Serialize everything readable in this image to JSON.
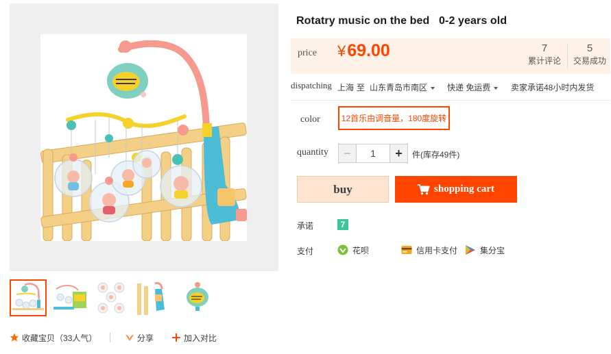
{
  "gallery": {
    "main_image_alt": "",
    "thumbnails": [
      "thumb-crib-mobile",
      "thumb-box",
      "thumb-figures",
      "thumb-arm",
      "thumb-speaker"
    ]
  },
  "actions": {
    "favorite_label": "收藏宝贝",
    "favorite_count": "（33人气）",
    "share_label": "分享",
    "compare_label": "加入对比"
  },
  "product": {
    "title": "Rotatry music on the bed   0-2 years old"
  },
  "price": {
    "label": "price",
    "currency": "¥",
    "amount": "69.00",
    "reviews_count": "7",
    "reviews_label": "累计评论",
    "sales_count": "5",
    "sales_label": "交易成功"
  },
  "dispatch": {
    "label": "dispatching",
    "from": "上海",
    "to_word": "至",
    "destination": "山东青岛市南区",
    "shipping": "快递 免运费",
    "promise": "卖家承诺48小时内发货"
  },
  "sku": {
    "color_label": "color",
    "color_option": "12首乐由调音量，180度旋转"
  },
  "quantity": {
    "label": "quantity",
    "minus": "−",
    "value": "1",
    "plus": "+",
    "stock": "件(库存49件)"
  },
  "buttons": {
    "buy": "buy",
    "cart": "shopping cart"
  },
  "meta": {
    "promise_label": "承诺",
    "promise_badge": "7",
    "payment_label": "支付",
    "payments": [
      "花呗",
      "信用卡支付",
      "集分宝"
    ]
  },
  "colors": {
    "accent": "#ff4400",
    "price_bg": "#fff2e8",
    "buy_bg": "#ffe4d0",
    "promise_green": "#3cc49d"
  },
  "icons": {
    "favorite": "star-icon",
    "share": "share-icon",
    "compare": "plus-icon",
    "cart": "cart-icon",
    "huabei": "huabei-icon",
    "credit": "credit-card-icon",
    "jifenbao": "jifenbao-icon"
  }
}
